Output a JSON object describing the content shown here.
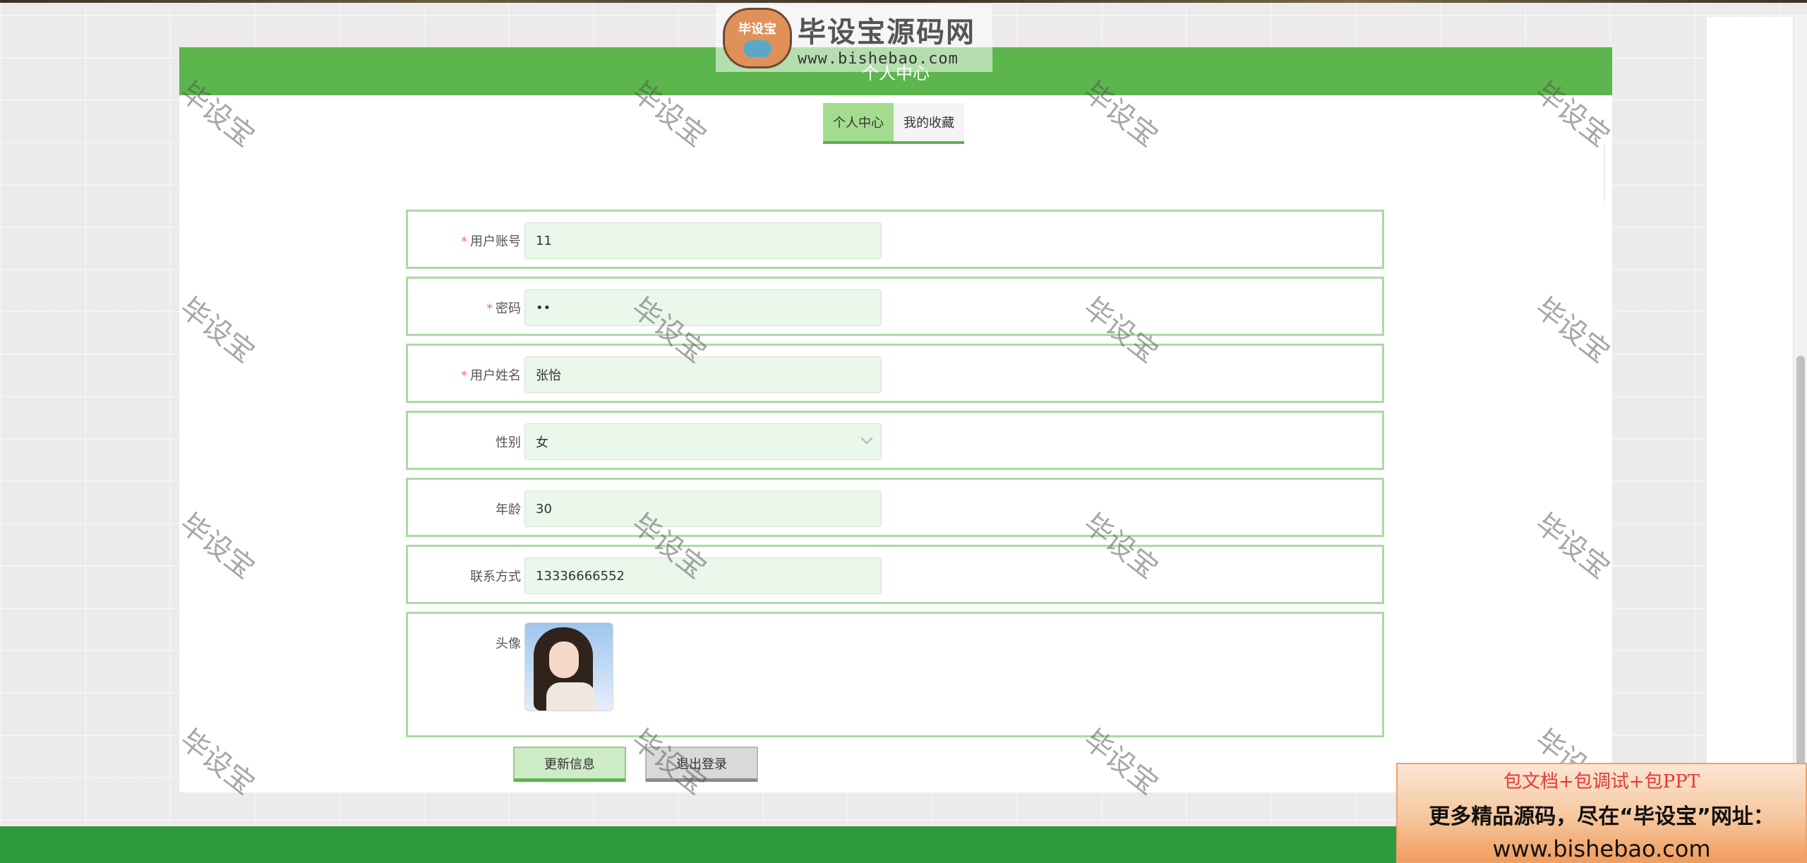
{
  "page": {
    "title": "个人中心"
  },
  "logo": {
    "badge": "毕设宝",
    "title": "毕设宝源码网",
    "url": "www.bishebao.com"
  },
  "tabs": [
    {
      "label": "个人中心",
      "active": true
    },
    {
      "label": "我的收藏",
      "active": false
    }
  ],
  "form": {
    "account": {
      "label": "用户账号",
      "required": true,
      "value": "11"
    },
    "password": {
      "label": "密码",
      "required": true,
      "value": "••"
    },
    "name": {
      "label": "用户姓名",
      "required": true,
      "value": "张怡"
    },
    "gender": {
      "label": "性别",
      "required": false,
      "value": "女"
    },
    "age": {
      "label": "年龄",
      "required": false,
      "value": "30"
    },
    "phone": {
      "label": "联系方式",
      "required": false,
      "value": "13336666552"
    },
    "avatar": {
      "label": "头像",
      "required": false
    }
  },
  "buttons": {
    "update": "更新信息",
    "logout": "退出登录"
  },
  "ad": {
    "line1": "包文档+包调试+包PPT",
    "line2": "更多精品源码，尽在“毕设宝”网址：",
    "line3": "www.bishebao.com"
  },
  "watermark": "毕设宝",
  "colors": {
    "primary": "#5cb54d",
    "footer": "#2d9a3e",
    "field_bg": "#ebf7ea",
    "row_border": "#a9dca0",
    "required": "#f56c6c"
  }
}
